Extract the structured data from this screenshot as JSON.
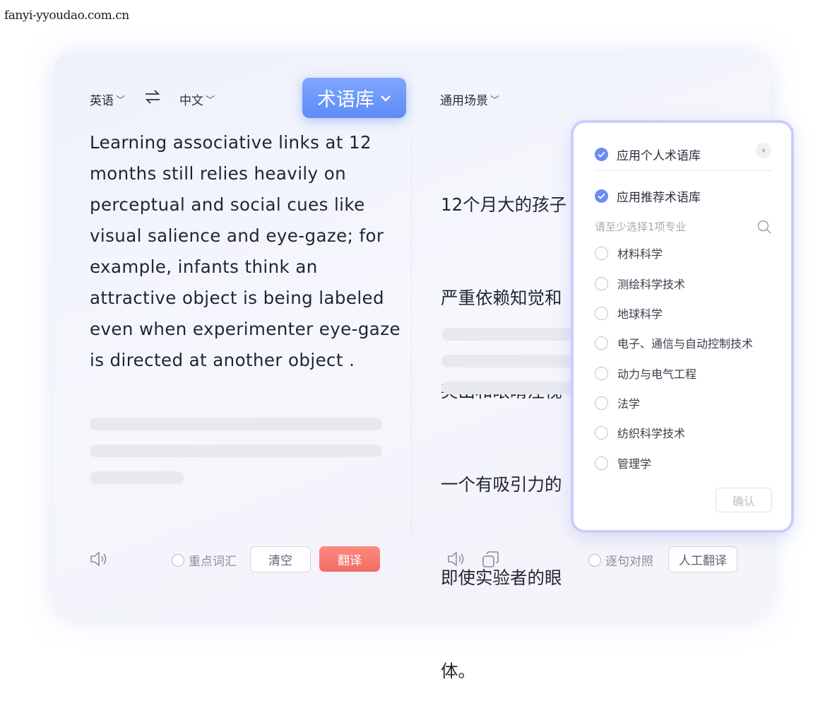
{
  "watermark": "fanyi-yyoudao.com.cn",
  "source_lang": "英语",
  "target_lang": "中文",
  "term_library_button": "术语库",
  "scene_select": "通用场景",
  "source_text": "Learning associative links at 12 months still relies heavily on perceptual and social cues like visual salience and eye-gaze; for example, infants think an attractive object is being labeled even when experimenter eye-gaze is directed at another object .",
  "target_lines": [
    "12个月大的孩子",
    "严重依赖知觉和",
    "突出和眼睛注视",
    "一个有吸引力的",
    "即使实验者的眼",
    "体。"
  ],
  "bottom_left": {
    "key_vocab_label": "重点词汇",
    "clear_label": "清空",
    "translate_label": "翻译"
  },
  "bottom_right": {
    "sentence_compare_label": "逐句对照",
    "human_translate_label": "人工翻译"
  },
  "panel": {
    "personal_library_label": "应用个人术语库",
    "recommended_library_label": "应用推荐术语库",
    "hint": "请至少选择1项专业",
    "fields": [
      "材料科学",
      "测绘科学技术",
      "地球科学",
      "电子、通信与自动控制技术",
      "动力与电气工程",
      "法学",
      "纺织科学技术",
      "管理学"
    ],
    "confirm_label": "确认"
  },
  "colors": {
    "accent": "#5d8cf6",
    "translate_button": "#f26c63",
    "panel_border": "#c9cdfd"
  }
}
